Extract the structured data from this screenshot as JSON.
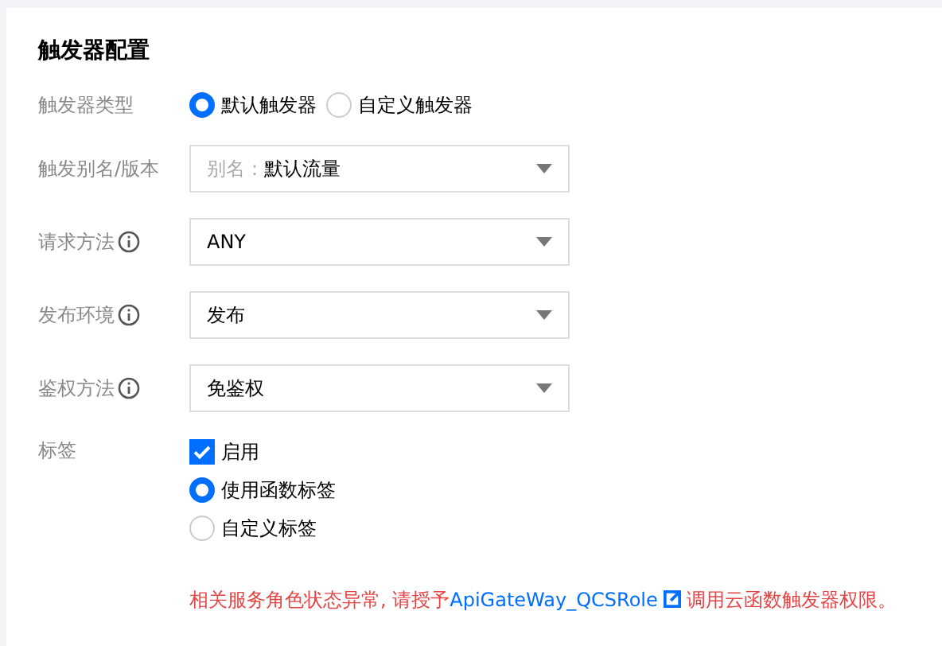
{
  "title": "触发器配置",
  "trigger_type": {
    "label": "触发器类型",
    "options": [
      {
        "label": "默认触发器",
        "selected": true
      },
      {
        "label": "自定义触发器",
        "selected": false
      }
    ]
  },
  "selects": [
    {
      "kind": "plain",
      "label": "触发别名/版本",
      "prefix": "别名：",
      "value": "默认流量"
    },
    {
      "kind": "info",
      "label": "请求方法",
      "value": "ANY"
    },
    {
      "kind": "info",
      "label": "发布环境",
      "value": "发布"
    },
    {
      "kind": "info",
      "label": "鉴权方法",
      "value": "免鉴权"
    }
  ],
  "tags": {
    "label": "标签",
    "enable": {
      "label": "启用",
      "checked": true
    },
    "options": [
      {
        "label": "使用函数标签",
        "selected": true
      },
      {
        "label": "自定义标签",
        "selected": false
      }
    ]
  },
  "warning": {
    "before": "相关服务角色状态异常, 请授予",
    "link": "ApiGateWay_QCSRole",
    "after": "调用云函数触发器权限。"
  }
}
